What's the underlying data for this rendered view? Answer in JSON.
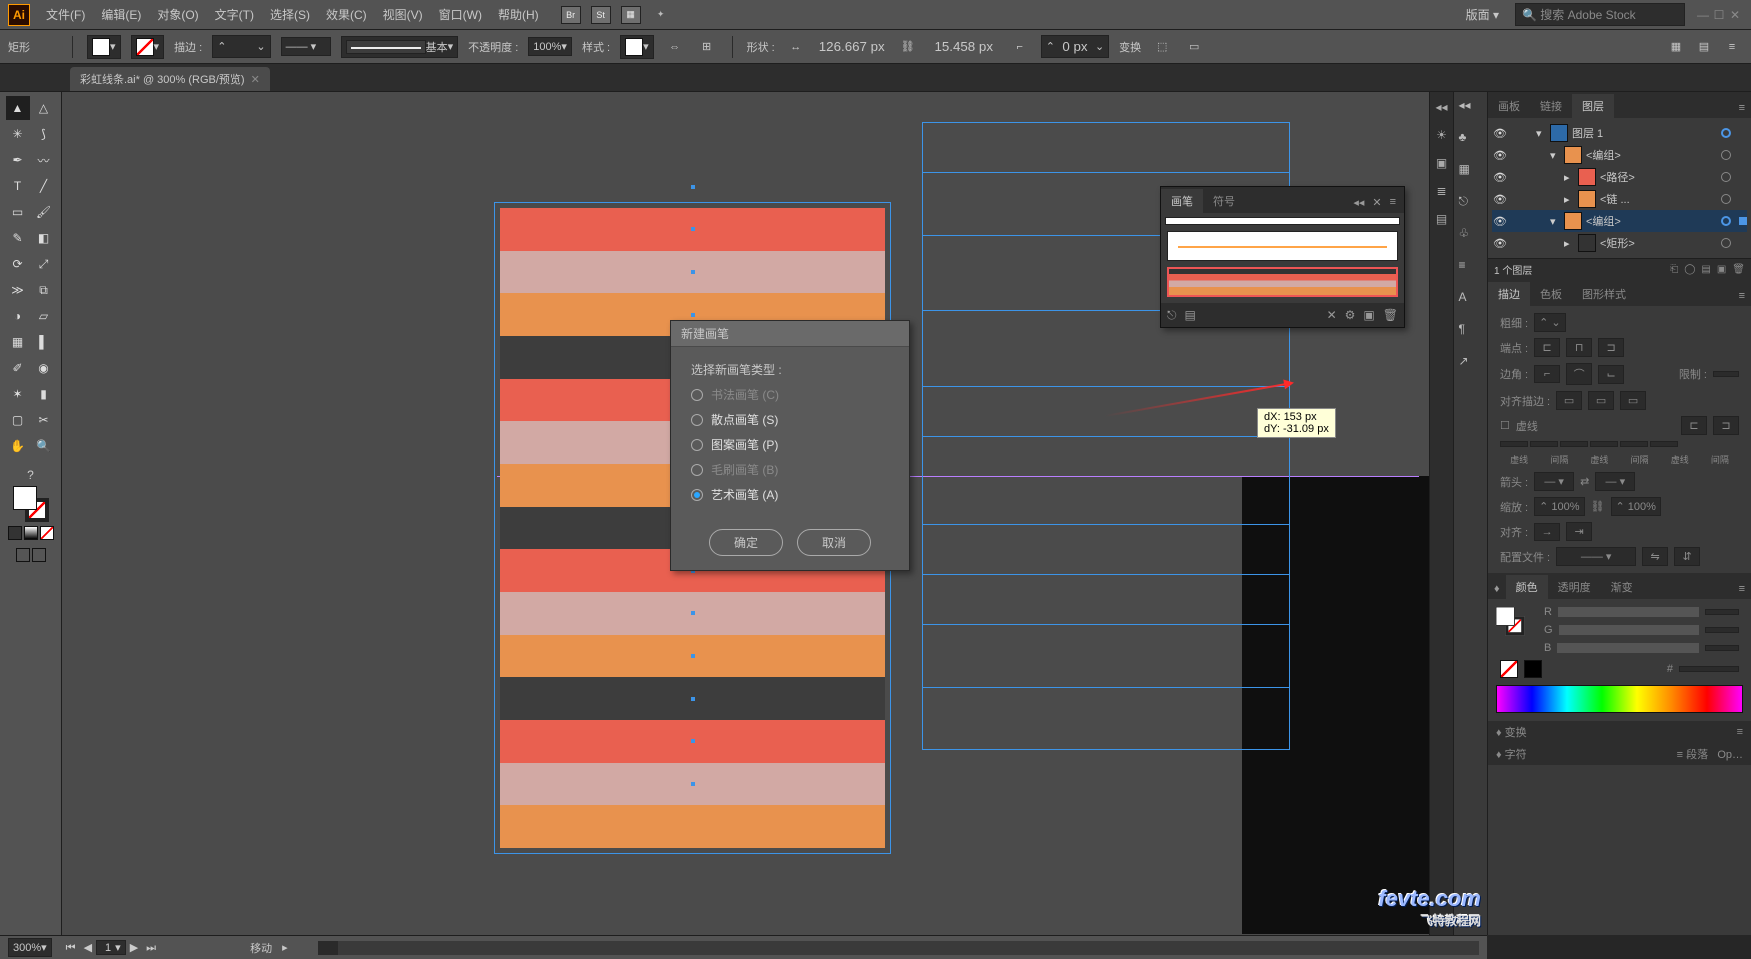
{
  "app": {
    "logo": "Ai"
  },
  "menus": [
    "文件(F)",
    "编辑(E)",
    "对象(O)",
    "文字(T)",
    "选择(S)",
    "效果(C)",
    "视图(V)",
    "窗口(W)",
    "帮助(H)"
  ],
  "app_icons": [
    "Br",
    "St"
  ],
  "workspace_label": "版面",
  "search_placeholder": "搜索 Adobe Stock",
  "tooltitle": "矩形",
  "options": {
    "stroke_label": "描边 :",
    "stroke_value": "",
    "stroke_style_label": "基本",
    "opacity_label": "不透明度 :",
    "opacity_value": "100%",
    "style_label": "样式 :",
    "shape_label": "形状 :",
    "width_value": "126.667 px",
    "height_value": "15.458 px",
    "corner_value": "0 px",
    "transform_label": "变换"
  },
  "doc_tab": {
    "title": "彩虹线条.ai* @ 300% (RGB/预览)"
  },
  "status": {
    "zoom": "300%",
    "page": "1",
    "tool": "移动"
  },
  "layers_panel": {
    "tabs": [
      "画板",
      "链接",
      "图层"
    ],
    "active": 2,
    "rows": [
      {
        "name": "图层 1",
        "indent": 0,
        "expand": true,
        "thumb": "#2d6aa8",
        "target": true
      },
      {
        "name": "<编组>",
        "indent": 1,
        "expand": true,
        "thumb": "#e8924e",
        "target": false
      },
      {
        "name": "<路径>",
        "indent": 2,
        "expand": false,
        "thumb": "#e96050",
        "target": false
      },
      {
        "name": "<链 ...",
        "indent": 2,
        "expand": false,
        "thumb": "#e8924e",
        "target": false
      },
      {
        "name": "<编组>",
        "indent": 1,
        "expand": true,
        "thumb": "#e8924e",
        "target": true,
        "selected": true
      },
      {
        "name": "<矩形>",
        "indent": 2,
        "expand": false,
        "thumb": "#333",
        "target": false
      }
    ],
    "footer": "1 个图层"
  },
  "stroke_panel": {
    "tabs": [
      "描边",
      "色板",
      "图形样式"
    ],
    "weight_label": "粗细 :",
    "cap_label": "端点 :",
    "corner_label": "边角 :",
    "limit_label": "限制 :",
    "align_label": "对齐描边 :",
    "dash_label": "虚线",
    "dash_col": [
      "虚线",
      "间隔",
      "虚线",
      "间隔",
      "虚线",
      "间隔"
    ],
    "arrow_label": "箭头 :",
    "scale_label": "缩放 :",
    "scale_value": "100%",
    "align_arrow_label": "对齐 :",
    "profile_label": "配置文件 :"
  },
  "color_panel": {
    "tabs": [
      "颜色",
      "透明度",
      "渐变"
    ],
    "channels": [
      "R",
      "G",
      "B"
    ]
  },
  "collapsed_panels": [
    "变换",
    "字符"
  ],
  "brush_panel": {
    "tabs": [
      "画笔",
      "符号"
    ]
  },
  "tooltip": {
    "dx": "dX: 153 px",
    "dy": "dY: -31.09 px"
  },
  "dialog": {
    "title": "新建画笔",
    "subtitle": "选择新画笔类型 :",
    "options": [
      {
        "label": "书法画笔 (C)",
        "disabled": true
      },
      {
        "label": "散点画笔 (S)",
        "disabled": false
      },
      {
        "label": "图案画笔 (P)",
        "disabled": false
      },
      {
        "label": "毛刷画笔 (B)",
        "disabled": true
      },
      {
        "label": "艺术画笔 (A)",
        "disabled": false,
        "checked": true
      }
    ],
    "ok": "确定",
    "cancel": "取消"
  },
  "stripes": [
    "#e96050",
    "#d2a9a4",
    "#e8924e",
    "#3d3d3d",
    "#e96050",
    "#d2a9a4",
    "#e8924e",
    "#3d3d3d",
    "#e96050",
    "#d2a9a4",
    "#e8924e",
    "#3d3d3d",
    "#e96050",
    "#d2a9a4",
    "#e8924e"
  ],
  "watermark": {
    "url": "fevte.com",
    "sub": "飞特教程网"
  },
  "chart_data": null
}
